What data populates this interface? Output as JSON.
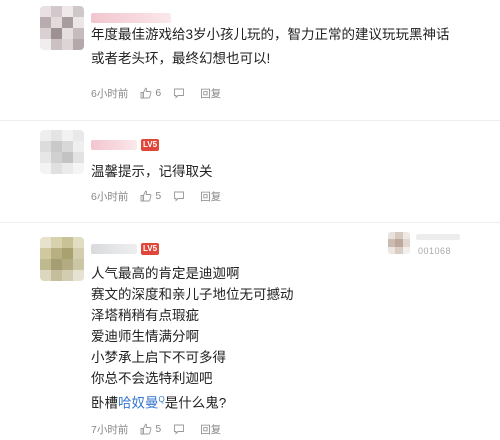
{
  "comments": [
    {
      "text_lines": [
        "年度最佳游戏给3岁小孩儿玩的，智力正常的建议玩玩黑神话",
        "或者老头环，最终幻想也可以!"
      ],
      "time": "6小时前",
      "likes": "6",
      "reply_label": "回复"
    },
    {
      "level_badge": "LV5",
      "text_lines": [
        "温馨提示，记得取关"
      ],
      "time": "6小时前",
      "likes": "5",
      "reply_label": "回复"
    },
    {
      "level_badge": "LV5",
      "text_lines": [
        "人气最高的肯定是迪迦啊",
        "赛文的深度和亲儿子地位无可撼动",
        "泽塔稍稍有点瑕疵",
        "爱迪师生情满分啊",
        "小梦承上启下不可多得",
        "你总不会选特利迦吧"
      ],
      "last_line_prefix": "卧槽",
      "last_line_link": "哈奴曼",
      "last_line_link_sup": "Q",
      "last_line_suffix": "是什么鬼?",
      "time": "7小时前",
      "likes": "5",
      "reply_label": "回复",
      "side_id": "001068"
    }
  ],
  "icons": {
    "like": "thumbs-up-icon",
    "comment": "comment-icon"
  },
  "colors": {
    "link": "#3a78d0",
    "badge": "#e0463a",
    "meta": "#888888"
  }
}
